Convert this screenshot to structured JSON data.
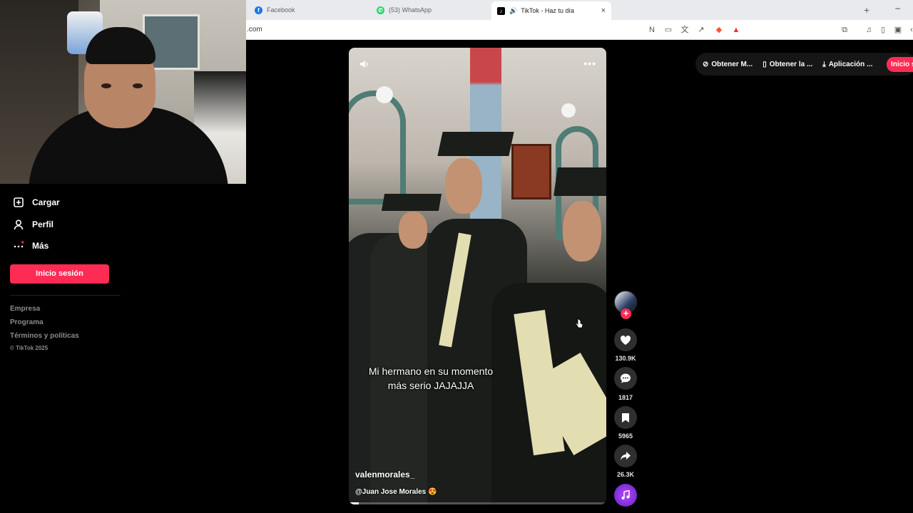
{
  "browser": {
    "tabs": [
      {
        "label": "Facebook",
        "icon": "facebook-icon",
        "color": "#1877f2"
      },
      {
        "label": "(53) WhatsApp",
        "icon": "whatsapp-icon",
        "color": "#25d366"
      },
      {
        "label": "TikTok - Haz tu día",
        "icon": "tiktok-icon",
        "color": "#000000",
        "active": true
      }
    ],
    "new_tab": "+",
    "address": ".com",
    "minimize": "–"
  },
  "sidebar": {
    "items": [
      {
        "label": "Cargar",
        "icon": "upload-plus-icon"
      },
      {
        "label": "Perfil",
        "icon": "person-icon"
      },
      {
        "label": "Más",
        "icon": "more-dots-icon"
      }
    ],
    "login_button": "Inicio sesión",
    "footer_links": [
      "Empresa",
      "Programa",
      "Términos y políticas"
    ],
    "copyright": "© TikTok 2025"
  },
  "video": {
    "caption_line1": "Mi hermano en su momento",
    "caption_line2": "más serio JAJAJJA",
    "username": "valenmorales_",
    "music": "@Juan Jose Morales 😍",
    "more": "•••",
    "progress": 0.04
  },
  "actions": {
    "likes": "130.9K",
    "comments": "1817",
    "saves": "5965",
    "shares": "26.3K"
  },
  "top_bar": {
    "items": [
      "Obtener M...",
      "Obtener la ...",
      "Aplicación ..."
    ],
    "login": "Inicio s"
  },
  "colors": {
    "accent": "#fe2c55",
    "music_disc": "#8e36e6"
  }
}
